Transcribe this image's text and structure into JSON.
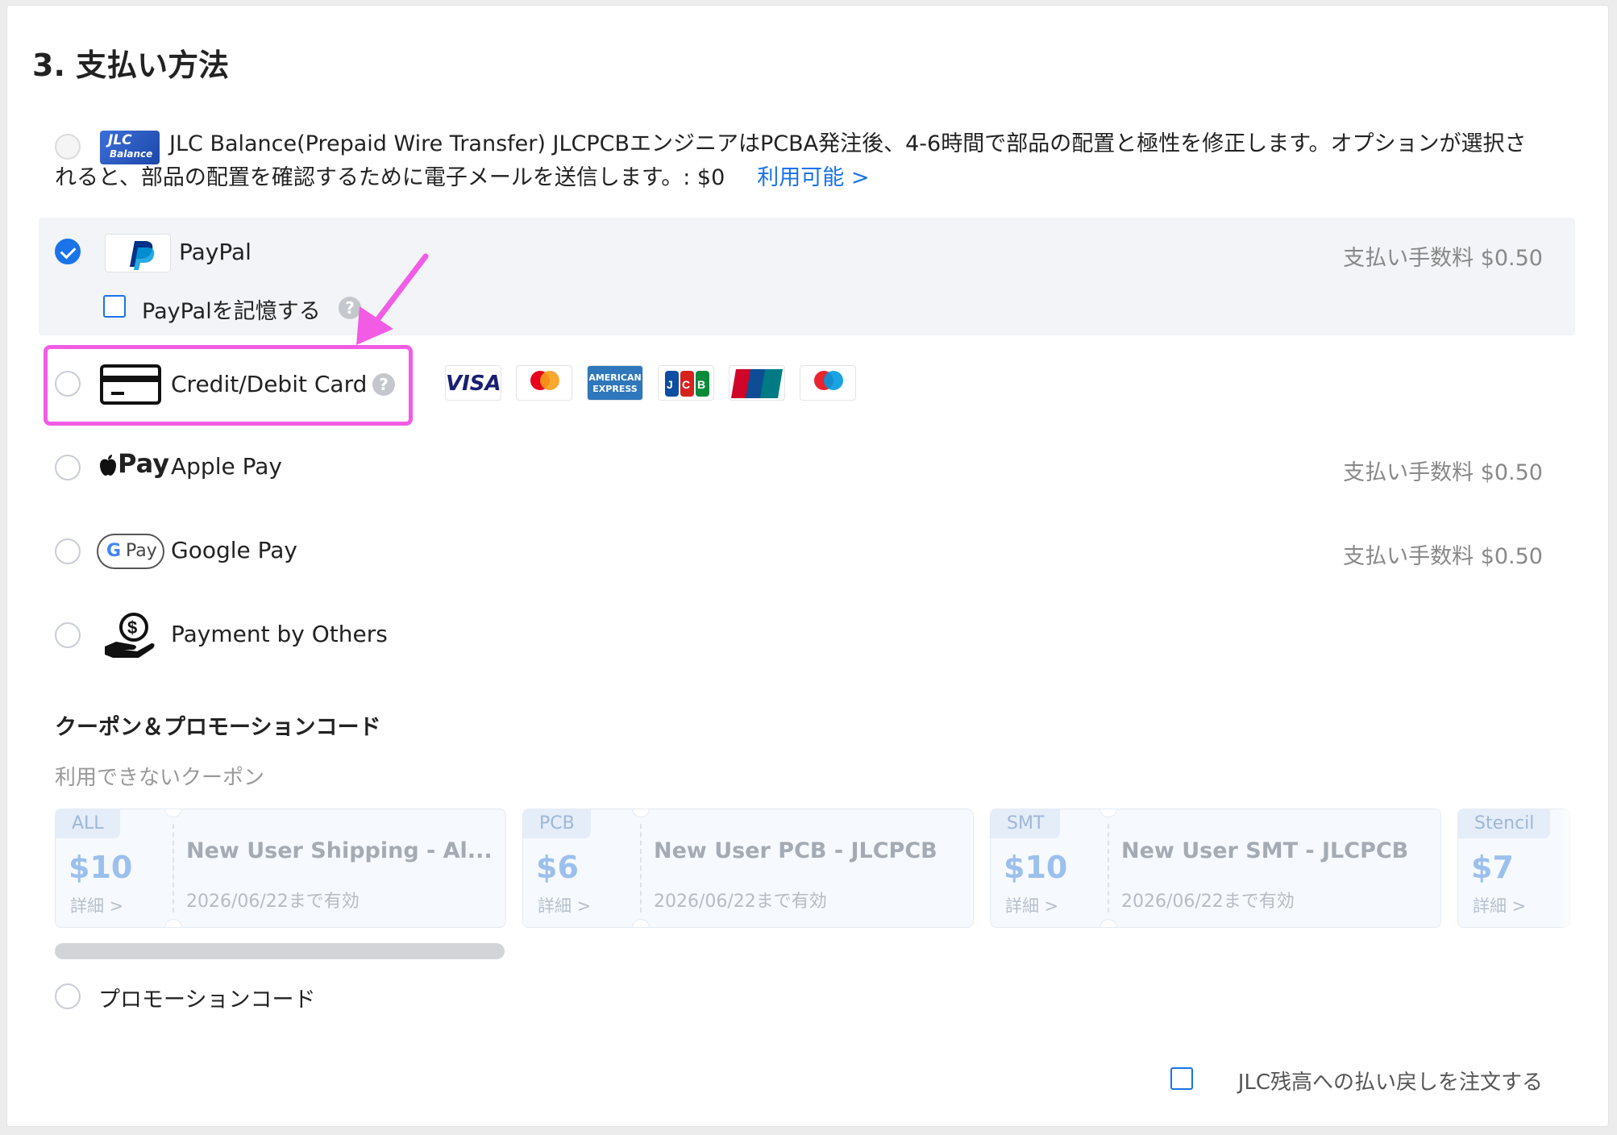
{
  "section": {
    "title": "3. 支払い方法"
  },
  "jlc_balance": {
    "logo_line1": "JLC",
    "logo_line2": "Balance",
    "text": "JLC Balance(Prepaid Wire Transfer) JLCPCBエンジニアはPCBA発注後、4-6時間で部品の配置と極性を修正します。オプションが選択されると、部品の配置を確認するために電子メールを送信します。: $0",
    "link": "利用可能 >"
  },
  "paypal": {
    "label": "PayPal",
    "fee": "支払い手数料 $0.50",
    "remember_label": "PayPalを記憶する",
    "help": "?"
  },
  "credit_card": {
    "label": "Credit/Debit Card",
    "help": "?",
    "brands": [
      {
        "name": "VISA",
        "color": "#1a1f71"
      },
      {
        "name": "mastercard",
        "color": "#eb001b"
      },
      {
        "name": "AMERICAN EXPRESS",
        "color": "#2e77bb"
      },
      {
        "name": "JCB",
        "color": "#0b4ea2"
      },
      {
        "name": "UnionPay 银联",
        "color": "#d10429"
      },
      {
        "name": "maestro",
        "color": "#0099df"
      }
    ]
  },
  "apple_pay": {
    "logo": "Pay",
    "label": "Apple Pay",
    "fee": "支払い手数料 $0.50"
  },
  "google_pay": {
    "logo_g": "G",
    "logo_text": "Pay",
    "label": "Google Pay",
    "fee": "支払い手数料 $0.50"
  },
  "others": {
    "label": "Payment by Others"
  },
  "coupons": {
    "title": "クーポン＆プロモーションコード",
    "unavailable_title": "利用できないクーポン",
    "items": [
      {
        "tag": "ALL",
        "amount": "$10",
        "details": "詳細 >",
        "name": "New User Shipping - Al...",
        "valid": "2026/06/22まで有効"
      },
      {
        "tag": "PCB",
        "amount": "$6",
        "details": "詳細 >",
        "name": "New User PCB - JLCPCB",
        "valid": "2026/06/22まで有効"
      },
      {
        "tag": "SMT",
        "amount": "$10",
        "details": "詳細 >",
        "name": "New User SMT - JLCPCB",
        "valid": "2026/06/22まで有効"
      },
      {
        "tag": "Stencil",
        "amount": "$7",
        "details": "詳細 >",
        "name": "",
        "valid": ""
      }
    ]
  },
  "promo": {
    "label": "プロモーションコード"
  },
  "refund": {
    "label": "JLC残高への払い戻しを注文する"
  },
  "colors": {
    "accent": "#1a73e8",
    "highlight": "#f25ce5",
    "paypal_dark": "#003087",
    "paypal_light": "#009cde"
  }
}
